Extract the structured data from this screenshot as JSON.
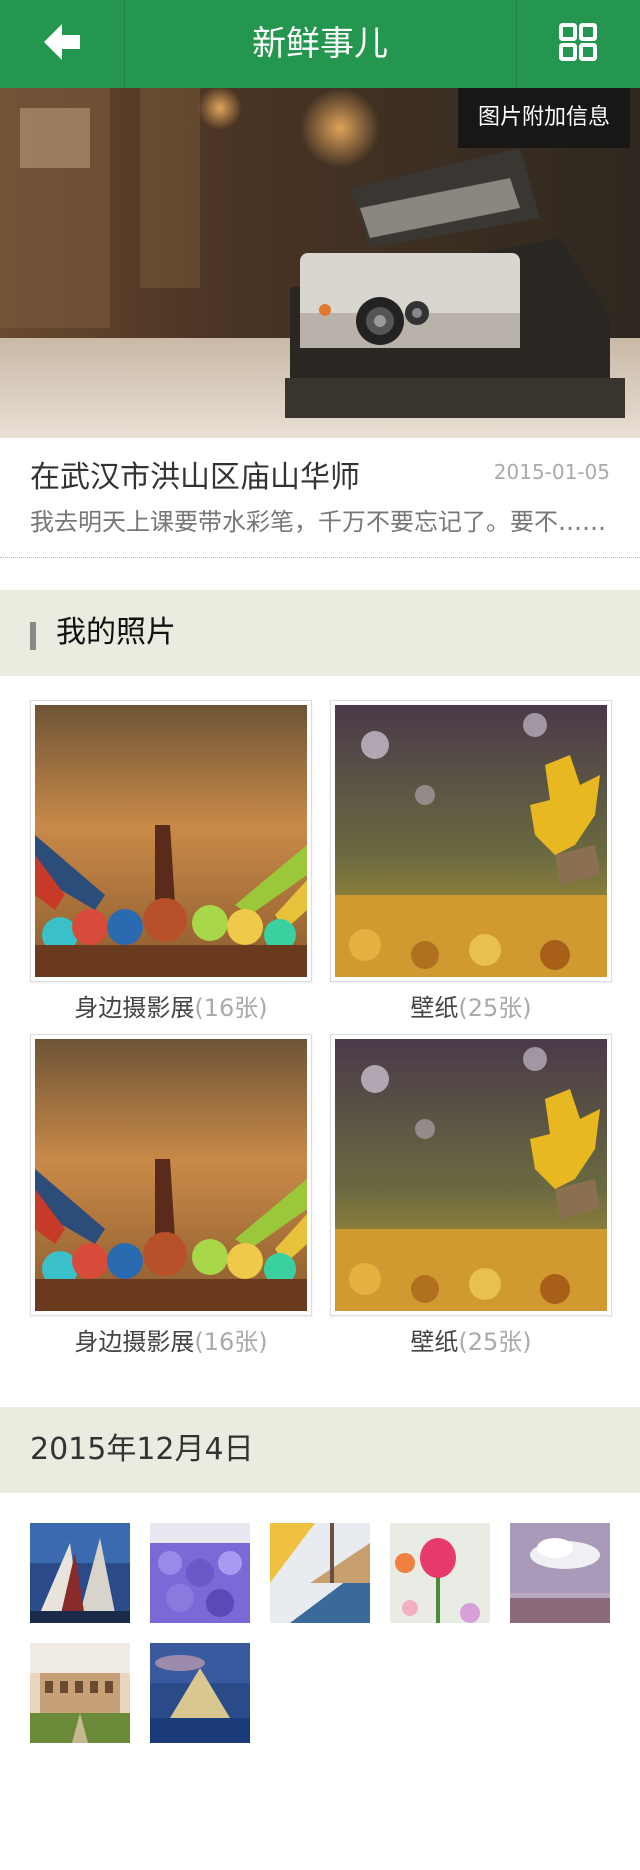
{
  "header": {
    "title": "新鲜事儿",
    "back_icon": "arrow-left-icon",
    "menu_icon": "grid-icon",
    "color": "#259650"
  },
  "hero": {
    "badge": "图片附加信息",
    "image": "polaroid-camera-photo"
  },
  "post": {
    "title": "在武汉市洪山区庙山华师",
    "date": "2015-01-05",
    "description": "我去明天上课要带水彩笔，千万不要忘记了。要不……"
  },
  "photos_section": {
    "title": "我的照片",
    "albums": [
      {
        "name": "身边摄影展",
        "count": "(16张)",
        "image": "colored-pencils-photo"
      },
      {
        "name": "壁纸",
        "count": "(25张)",
        "image": "autumn-leaf-photo"
      },
      {
        "name": "身边摄影展",
        "count": "(16张)",
        "image": "colored-pencils-photo"
      },
      {
        "name": "壁纸",
        "count": "(25张)",
        "image": "autumn-leaf-photo"
      }
    ]
  },
  "date_section": {
    "title": "2015年12月4日",
    "thumbnails": [
      {
        "image": "gondolas-photo"
      },
      {
        "image": "lavender-field-photo"
      },
      {
        "image": "sailboat-photo"
      },
      {
        "image": "tulip-photo"
      },
      {
        "image": "cloud-sky-photo"
      },
      {
        "image": "colosseum-photo"
      },
      {
        "image": "louvre-pyramid-photo"
      }
    ]
  }
}
